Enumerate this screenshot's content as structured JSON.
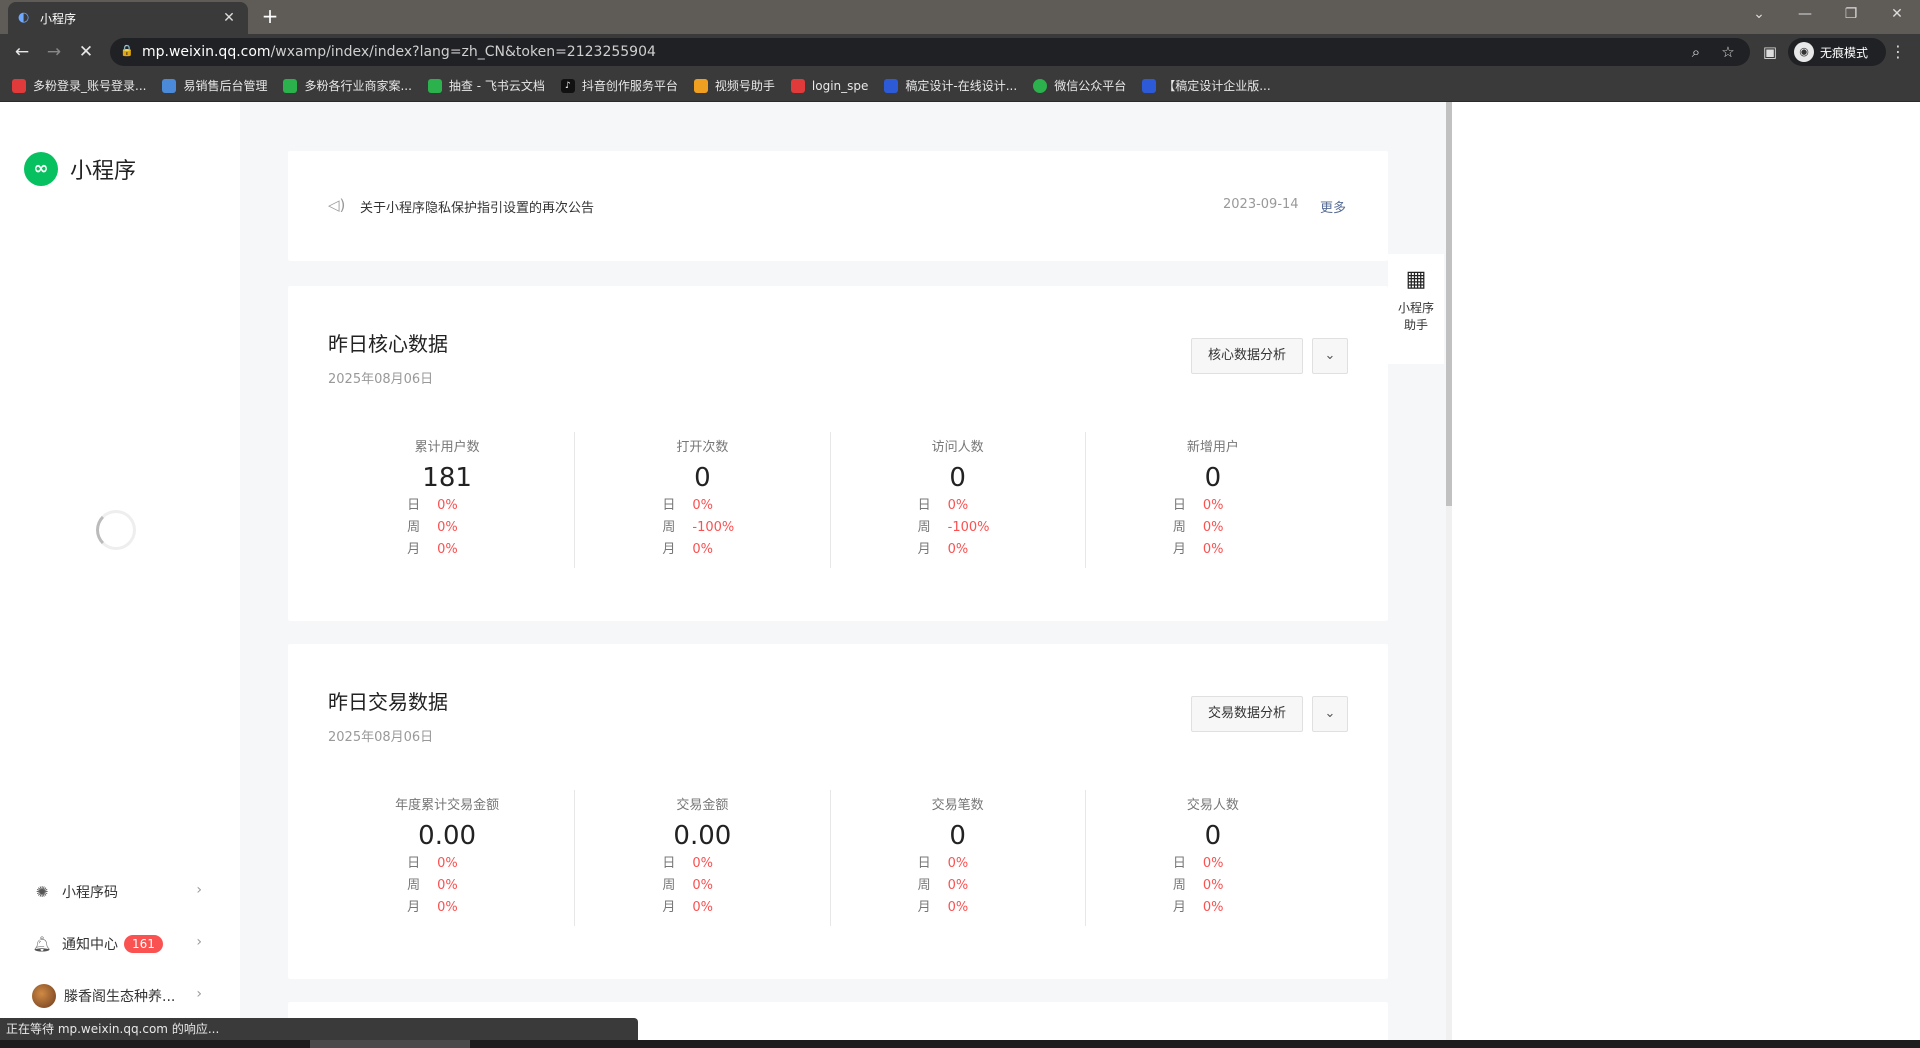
{
  "browser": {
    "tab_title": "小程序",
    "tab_close": "✕",
    "new_tab": "+",
    "window_controls": [
      "⌄",
      "—",
      "❐",
      "✕"
    ],
    "url_host": "mp.weixin.qq.com",
    "url_path": "/wxamp/index/index?lang=zh_CN&token=2123255904",
    "incognito_label": "无痕模式",
    "bookmarks": [
      {
        "label": "多粉登录_账号登录...",
        "color": "#e03a3a"
      },
      {
        "label": "易销售后台管理",
        "color": "#4a8ad8"
      },
      {
        "label": "多粉各行业商家案...",
        "color": "#2bb24c"
      },
      {
        "label": "抽查 - 飞书云文档",
        "color": "#2bb24c"
      },
      {
        "label": "抖音创作服务平台",
        "color": "#111111"
      },
      {
        "label": "视频号助手",
        "color": "#f0a020"
      },
      {
        "label": "login_spe",
        "color": "#e03a3a"
      },
      {
        "label": "稿定设计-在线设计...",
        "color": "#2d5bd8"
      },
      {
        "label": "微信公众平台",
        "color": "#2bb24c"
      },
      {
        "label": "【稿定设计企业版...",
        "color": "#2d5bd8"
      }
    ]
  },
  "sidebar": {
    "app_name": "小程序",
    "items": [
      {
        "label": "小程序码",
        "icon": "qrcode-sun-icon"
      },
      {
        "label": "通知中心",
        "icon": "bell-icon",
        "badge": "161"
      },
      {
        "label": "滕香阁生态种养...",
        "icon": "avatar"
      }
    ]
  },
  "notice": {
    "text": "关于小程序隐私保护指引设置的再次公告",
    "date": "2023-09-14",
    "more": "更多"
  },
  "helper": {
    "label_line1": "小程序",
    "label_line2": "助手"
  },
  "core": {
    "title": "昨日核心数据",
    "date": "2025年08月06日",
    "analysis_button": "核心数据分析",
    "metrics": [
      {
        "label": "累计用户数",
        "value": "181",
        "day": "0%",
        "week": "0%",
        "month": "0%"
      },
      {
        "label": "打开次数",
        "value": "0",
        "day": "0%",
        "week": "-100%",
        "month": "0%"
      },
      {
        "label": "访问人数",
        "value": "0",
        "day": "0%",
        "week": "-100%",
        "month": "0%"
      },
      {
        "label": "新增用户",
        "value": "0",
        "day": "0%",
        "week": "0%",
        "month": "0%"
      }
    ]
  },
  "trade": {
    "title": "昨日交易数据",
    "date": "2025年08月06日",
    "analysis_button": "交易数据分析",
    "metrics": [
      {
        "label": "年度累计交易金额",
        "value": "0.00",
        "day": "0%",
        "week": "0%",
        "month": "0%"
      },
      {
        "label": "交易金额",
        "value": "0.00",
        "day": "0%",
        "week": "0%",
        "month": "0%"
      },
      {
        "label": "交易笔数",
        "value": "0",
        "day": "0%",
        "week": "0%",
        "month": "0%"
      },
      {
        "label": "交易人数",
        "value": "0",
        "day": "0%",
        "week": "0%",
        "month": "0%"
      }
    ]
  },
  "period_labels": {
    "day": "日",
    "week": "周",
    "month": "月"
  },
  "status_text": "正在等待 mp.weixin.qq.com 的响应..."
}
